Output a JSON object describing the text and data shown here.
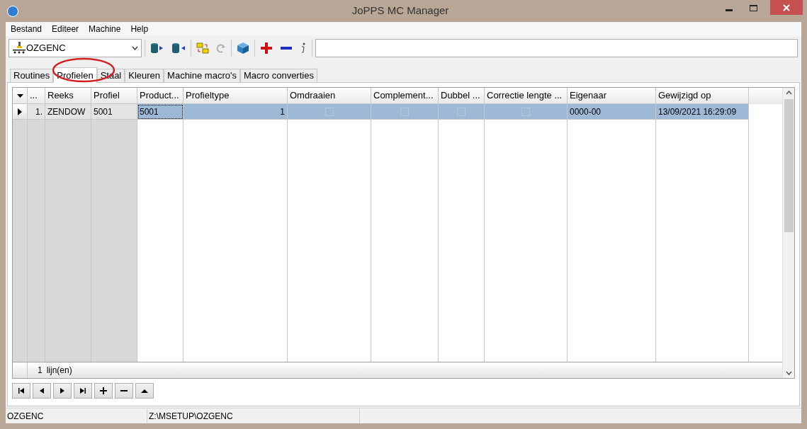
{
  "window": {
    "title": "JoPPS MC Manager"
  },
  "menu": [
    "Bestand",
    "Editeer",
    "Machine",
    "Help"
  ],
  "toolbar": {
    "machine": "OZGENC"
  },
  "tabs": [
    {
      "label": "Routines",
      "selected": false
    },
    {
      "label": "Profielen",
      "selected": true
    },
    {
      "label": "Staal",
      "selected": false
    },
    {
      "label": "Kleuren",
      "selected": false
    },
    {
      "label": "Machine macro's",
      "selected": false
    },
    {
      "label": "Macro converties",
      "selected": false
    }
  ],
  "table": {
    "columns": [
      "...",
      "Reeks",
      "Profiel",
      "Product...",
      "Profieltype",
      "Omdraaien",
      "Complement...",
      "Dubbel ...",
      "Correctie lengte ...",
      "Eigenaar",
      "Gewijzigd op"
    ],
    "rows": [
      {
        "selected": true,
        "cells": [
          "1.",
          "ZENDOW",
          "5001",
          "5001",
          "1",
          {
            "checked": false
          },
          {
            "checked": false
          },
          {
            "checked": false
          },
          {
            "checked": false
          },
          "0000-00",
          "13/09/2021 16:29:09"
        ]
      }
    ],
    "footer": {
      "count": "1",
      "label": "lijn(en)"
    }
  },
  "status_bar": [
    "OZGENC",
    "Z:\\MSETUP\\OZGENC"
  ]
}
